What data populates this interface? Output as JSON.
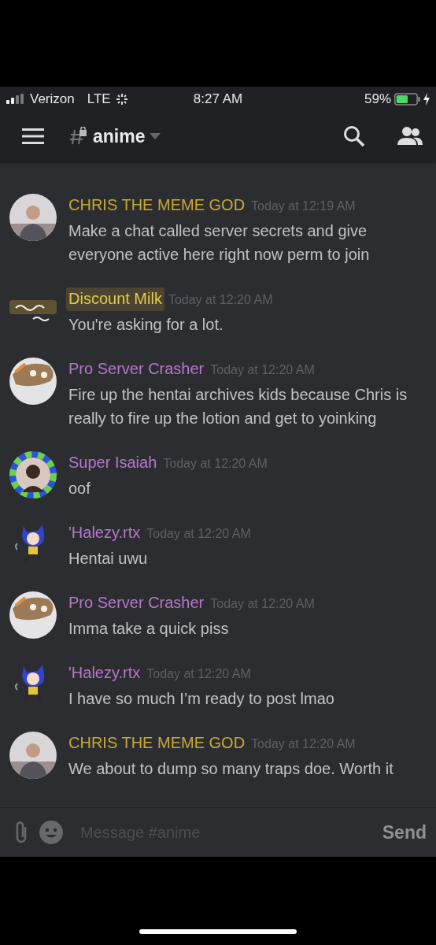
{
  "status_bar": {
    "carrier": "Verizon",
    "network": "LTE",
    "time": "8:27 AM",
    "battery": "59%"
  },
  "header": {
    "channel": "anime"
  },
  "messages": [
    {
      "author": "CHRIS THE MEME GOD",
      "color": "#c9a932",
      "highlighted": false,
      "timestamp": "Today at 12:19 AM",
      "text": "Make a chat called server secrets and give everyone active here right now perm to join",
      "avatar": {
        "kind": "photo"
      }
    },
    {
      "author": "Discount Milk",
      "color": "#e6c94a",
      "highlighted": true,
      "timestamp": "Today at 12:20 AM",
      "text": "You're asking for a lot.",
      "avatar": {
        "kind": "logo"
      }
    },
    {
      "author": "Pro Server Crasher",
      "color": "#b677cc",
      "highlighted": false,
      "timestamp": "Today at 12:20 AM",
      "text": "Fire up the hentai archives kids because Chris is really to fire up the lotion and get to yoinking",
      "avatar": {
        "kind": "cartoon"
      }
    },
    {
      "author": "Super Isaiah",
      "color": "#b677cc",
      "highlighted": false,
      "timestamp": "Today at 12:20 AM",
      "text": "oof",
      "avatar": {
        "kind": "ring"
      }
    },
    {
      "author": "'Halezy.rtx",
      "color": "#b677cc",
      "highlighted": false,
      "timestamp": "Today at 12:20 AM",
      "text": "Hentai uwu",
      "avatar": {
        "kind": "figure"
      }
    },
    {
      "author": "Pro Server Crasher",
      "color": "#b677cc",
      "highlighted": false,
      "timestamp": "Today at 12:20 AM",
      "text": "Imma take a quick piss",
      "avatar": {
        "kind": "cartoon"
      }
    },
    {
      "author": "'Halezy.rtx",
      "color": "#b677cc",
      "highlighted": false,
      "timestamp": "Today at 12:20 AM",
      "text": "I have so much I’m ready to post lmao",
      "avatar": {
        "kind": "figure"
      }
    },
    {
      "author": "CHRIS THE MEME GOD",
      "color": "#c9a932",
      "highlighted": false,
      "timestamp": "Today at 12:20 AM",
      "text": "We about to dump so many traps doe. Worth it",
      "avatar": {
        "kind": "photo"
      }
    }
  ],
  "input": {
    "placeholder": "Message #anime",
    "send": "Send"
  }
}
